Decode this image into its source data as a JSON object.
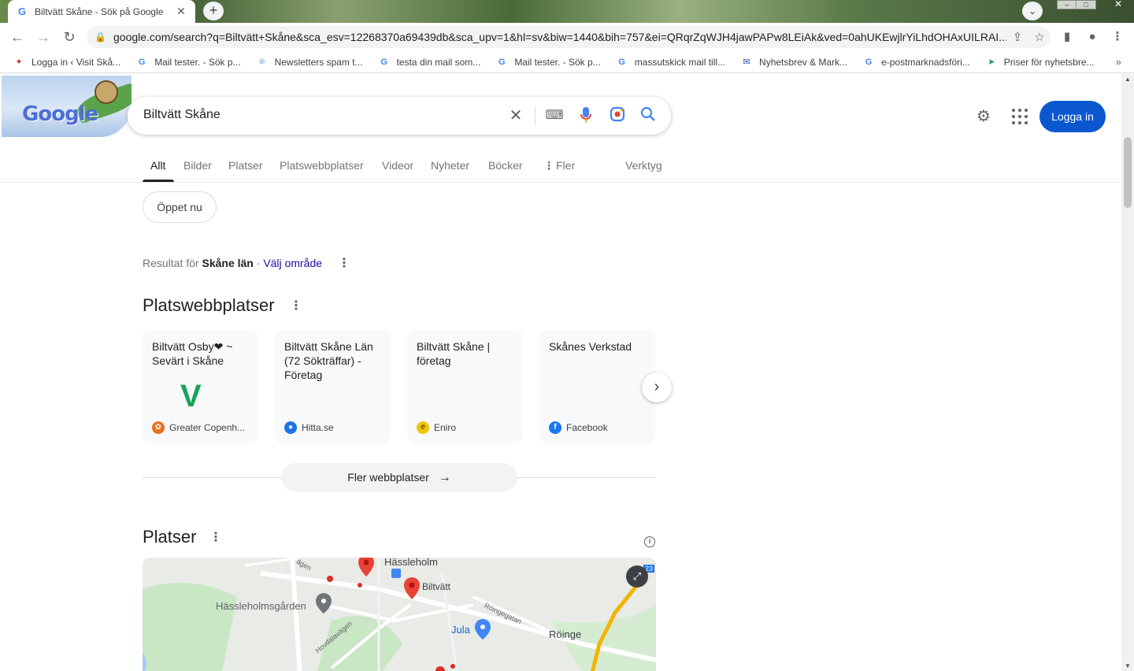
{
  "browser": {
    "tab_title": "Biltvätt Skåne - Sök på Google",
    "tab_favicon": "G",
    "url": "google.com/search?q=Biltvätt+Skåne&sca_esv=12268370a69439db&sca_upv=1&hl=sv&biw=1440&bih=757&ei=QRqrZqWJH4jawPAPw8LEiAk&ved=0ahUKEwjlrYiLhdOHAxUILRAI...",
    "bookmarks": [
      {
        "label": "Logga in ‹ Visit Skå...",
        "icon": "visit-skane-icon",
        "glyph": "✦",
        "color": "#d93025"
      },
      {
        "label": "Mail tester. - Sök p...",
        "icon": "google-icon",
        "glyph": "G",
        "color": "#4285f4"
      },
      {
        "label": "Newsletters spam t...",
        "icon": "snowflake-icon",
        "glyph": "❄",
        "color": "#8ab4f8"
      },
      {
        "label": "testa din mail som...",
        "icon": "google-icon",
        "glyph": "G",
        "color": "#4285f4"
      },
      {
        "label": "Mail tester. - Sök p...",
        "icon": "google-icon",
        "glyph": "G",
        "color": "#4285f4"
      },
      {
        "label": "massutskick mail till...",
        "icon": "google-icon",
        "glyph": "G",
        "color": "#4285f4"
      },
      {
        "label": "Nyhetsbrev & Mark...",
        "icon": "envelope-icon",
        "glyph": "✉",
        "color": "#1a4fb5"
      },
      {
        "label": "e-postmarknadsföri...",
        "icon": "google-icon",
        "glyph": "G",
        "color": "#4285f4"
      },
      {
        "label": "Priser för nyhetsbre...",
        "icon": "send-icon",
        "glyph": "➤",
        "color": "#0f9d58"
      }
    ]
  },
  "search": {
    "query": "Biltvätt Skåne",
    "doodle_text": "Google"
  },
  "header": {
    "login_label": "Logga in"
  },
  "tabs": [
    "Allt",
    "Bilder",
    "Platser",
    "Platswebbplatser",
    "Videor",
    "Nyheter",
    "Böcker",
    "Fler",
    "Verktyg"
  ],
  "chip": "Öppet nu",
  "region": {
    "prefix": "Resultat för",
    "place": "Skåne län",
    "sep": " · ",
    "link": "Välj område"
  },
  "platswebbplatser": {
    "heading": "Platswebbplatser",
    "cards": [
      {
        "title": "Biltvätt Osby❤ ~ Sevärt i Skåne",
        "source": "Greater Copenh...",
        "icon": "greater-copenhagen-icon",
        "icon_color": "#e8711a",
        "logo": "V"
      },
      {
        "title": "Biltvätt Skåne Län (72 Sökträffar) - Företag",
        "source": "Hitta.se",
        "icon": "hitta-icon",
        "icon_color": "#1a73e8",
        "logo": ""
      },
      {
        "title": "Biltvätt Skåne | företag",
        "source": "Eniro",
        "icon": "eniro-icon",
        "icon_color": "#f2c500",
        "logo": ""
      },
      {
        "title": "Skånes Verkstad",
        "source": "Facebook",
        "icon": "facebook-icon",
        "icon_color": "#1877f2",
        "logo": ""
      }
    ],
    "more_label": "Fler webbplatser"
  },
  "platser": {
    "heading": "Platser",
    "map_labels": {
      "hassleholm": "Hässleholm",
      "biltvatt": "Biltvätt",
      "hassleholmsgarden": "Hässleholmsgården",
      "jula": "Jula",
      "roinge": "Röinge",
      "roingegatan": "Röingegatan",
      "hovdalavagen": "Hovdalavägen",
      "road_23": "23",
      "road_fragment": "ägen"
    }
  }
}
